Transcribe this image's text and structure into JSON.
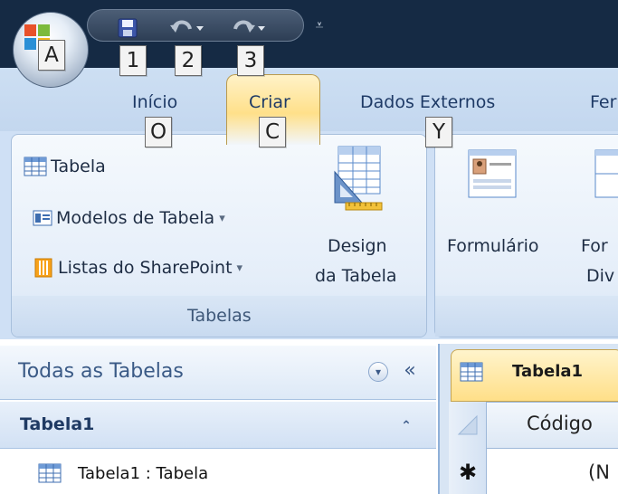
{
  "window": {
    "title_bar_color": "#152a44",
    "qat_overflow_glyph": "⩡"
  },
  "keytips": {
    "office": "A",
    "save": "1",
    "undo": "2",
    "redo": "3",
    "inicio": "O",
    "criar": "C",
    "dados_externos": "Y"
  },
  "tabs": {
    "inicio": "Início",
    "criar": "Criar",
    "dados_externos": "Dados Externos",
    "ferramentas": "Fer"
  },
  "ribbon": {
    "tabelas_group": {
      "label": "Tabelas",
      "tabela": "Tabela",
      "modelos": "Modelos de Tabela",
      "listas": "Listas do SharePoint",
      "design_line1": "Design",
      "design_line2": "da Tabela",
      "dropdown_glyph": "▾"
    },
    "forms_group": {
      "formulario": "Formulário",
      "formulario_dividido_line1": "For",
      "formulario_dividido_line2": "Div"
    }
  },
  "nav_pane": {
    "header": "Todas as Tabelas",
    "dropdown_glyph": "▾",
    "collapse_glyph": "«",
    "group": "Tabela1",
    "group_toggle_glyph": "⌃",
    "item": "Tabela1 : Tabela"
  },
  "document": {
    "tab": "Tabela1",
    "column_header": "Código",
    "new_record_glyph": "✱",
    "new_value": "(N"
  }
}
